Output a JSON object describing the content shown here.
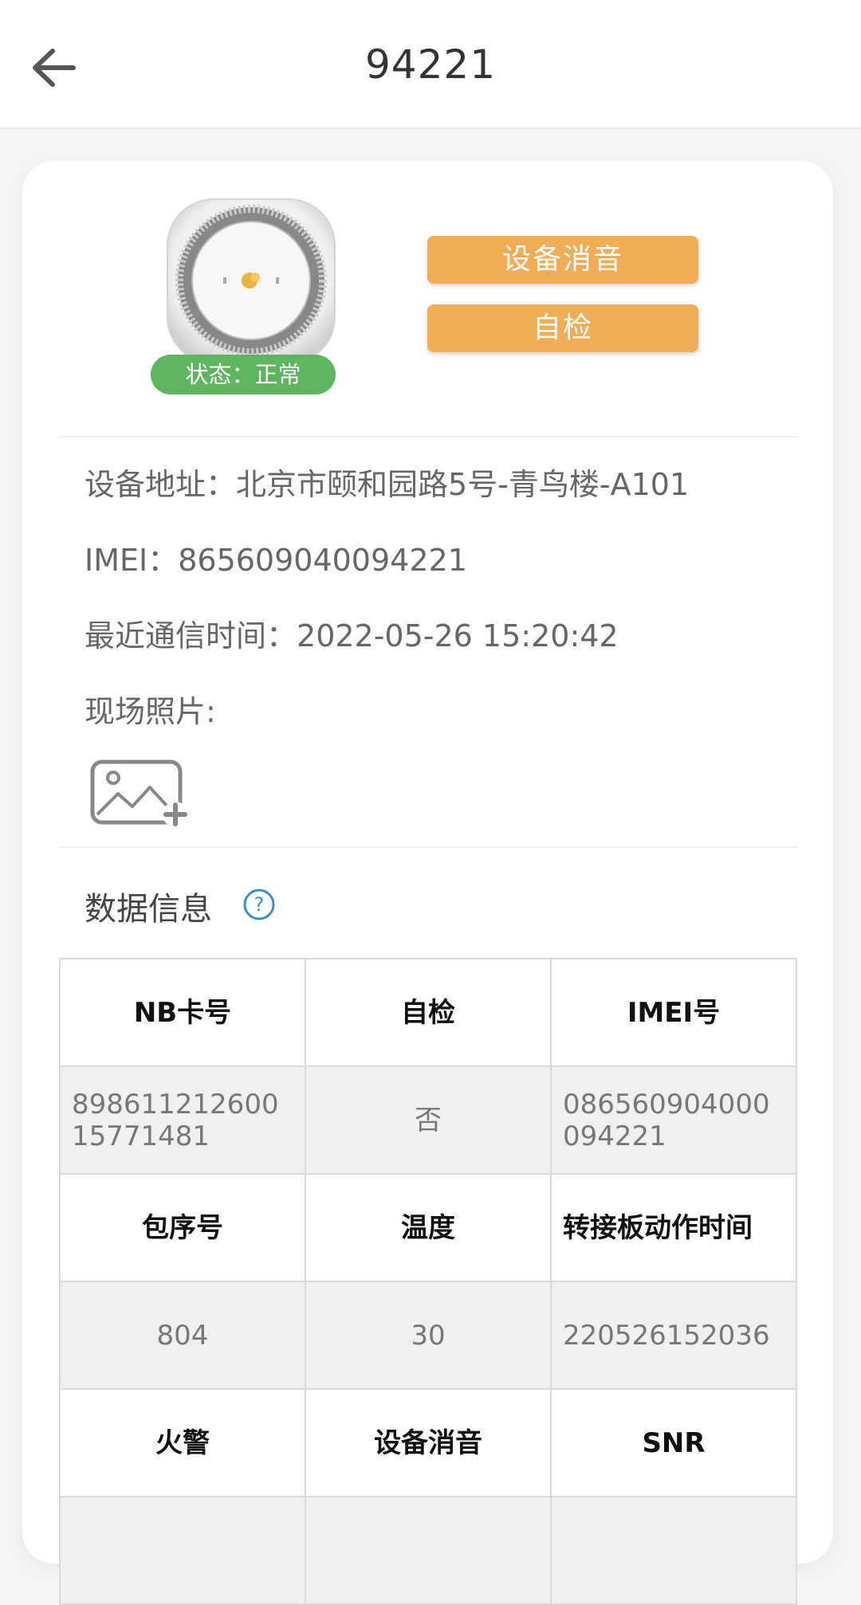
{
  "header": {
    "title": "94221",
    "back_icon": "arrow-left-icon"
  },
  "device": {
    "image_icon": "smoke-detector-device",
    "status": "状态：正常",
    "status_color": "#5fb55f",
    "mute_button": "设备消音",
    "selfcheck_button": "自检",
    "button_color": "#f0ad55"
  },
  "info": {
    "address_label": "设备地址：",
    "address_value": "北京市颐和园路5号-青鸟楼-A101",
    "imei_label": "IMEI：",
    "imei_value": "865609040094221",
    "last_comm_label": "最近通信时间：",
    "last_comm_value": "2022-05-26 15:20:42",
    "photo_label": "现场照片:",
    "photo_add_icon": "image-add-icon"
  },
  "data_section": {
    "title": "数据信息",
    "help_icon": "question-circle-icon",
    "rows": [
      {
        "type": "head",
        "cells": [
          "NB卡号",
          "自检",
          "IMEI号"
        ]
      },
      {
        "type": "val",
        "cells": [
          "89861121260015771481",
          "否",
          "086560904000094221"
        ]
      },
      {
        "type": "head",
        "cells": [
          "包序号",
          "温度",
          "转接板动作时间"
        ]
      },
      {
        "type": "val",
        "cells": [
          "804",
          "30",
          "220526152036"
        ]
      },
      {
        "type": "head",
        "cells": [
          "火警",
          "设备消音",
          "SNR"
        ]
      },
      {
        "type": "val",
        "cells": [
          "",
          "",
          ""
        ]
      }
    ]
  }
}
